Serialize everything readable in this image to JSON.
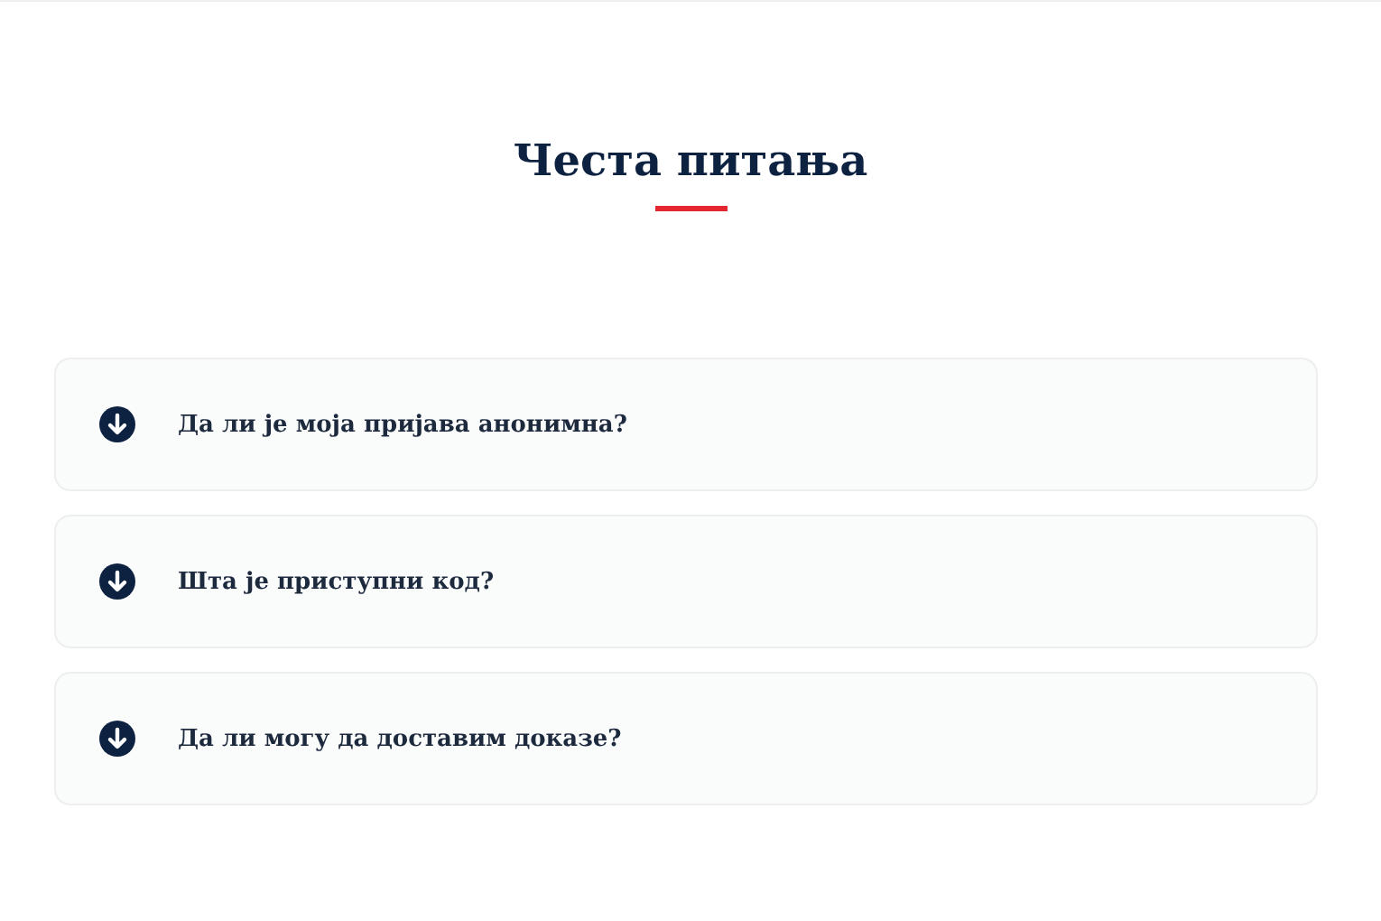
{
  "heading": "Честа питања",
  "faq": [
    {
      "question": "Да ли је моја пријава анонимна?",
      "expanded": false
    },
    {
      "question": "Шта је приступни код?",
      "expanded": false
    },
    {
      "question": "Да ли могу да доставим доказе?",
      "expanded": false
    }
  ]
}
